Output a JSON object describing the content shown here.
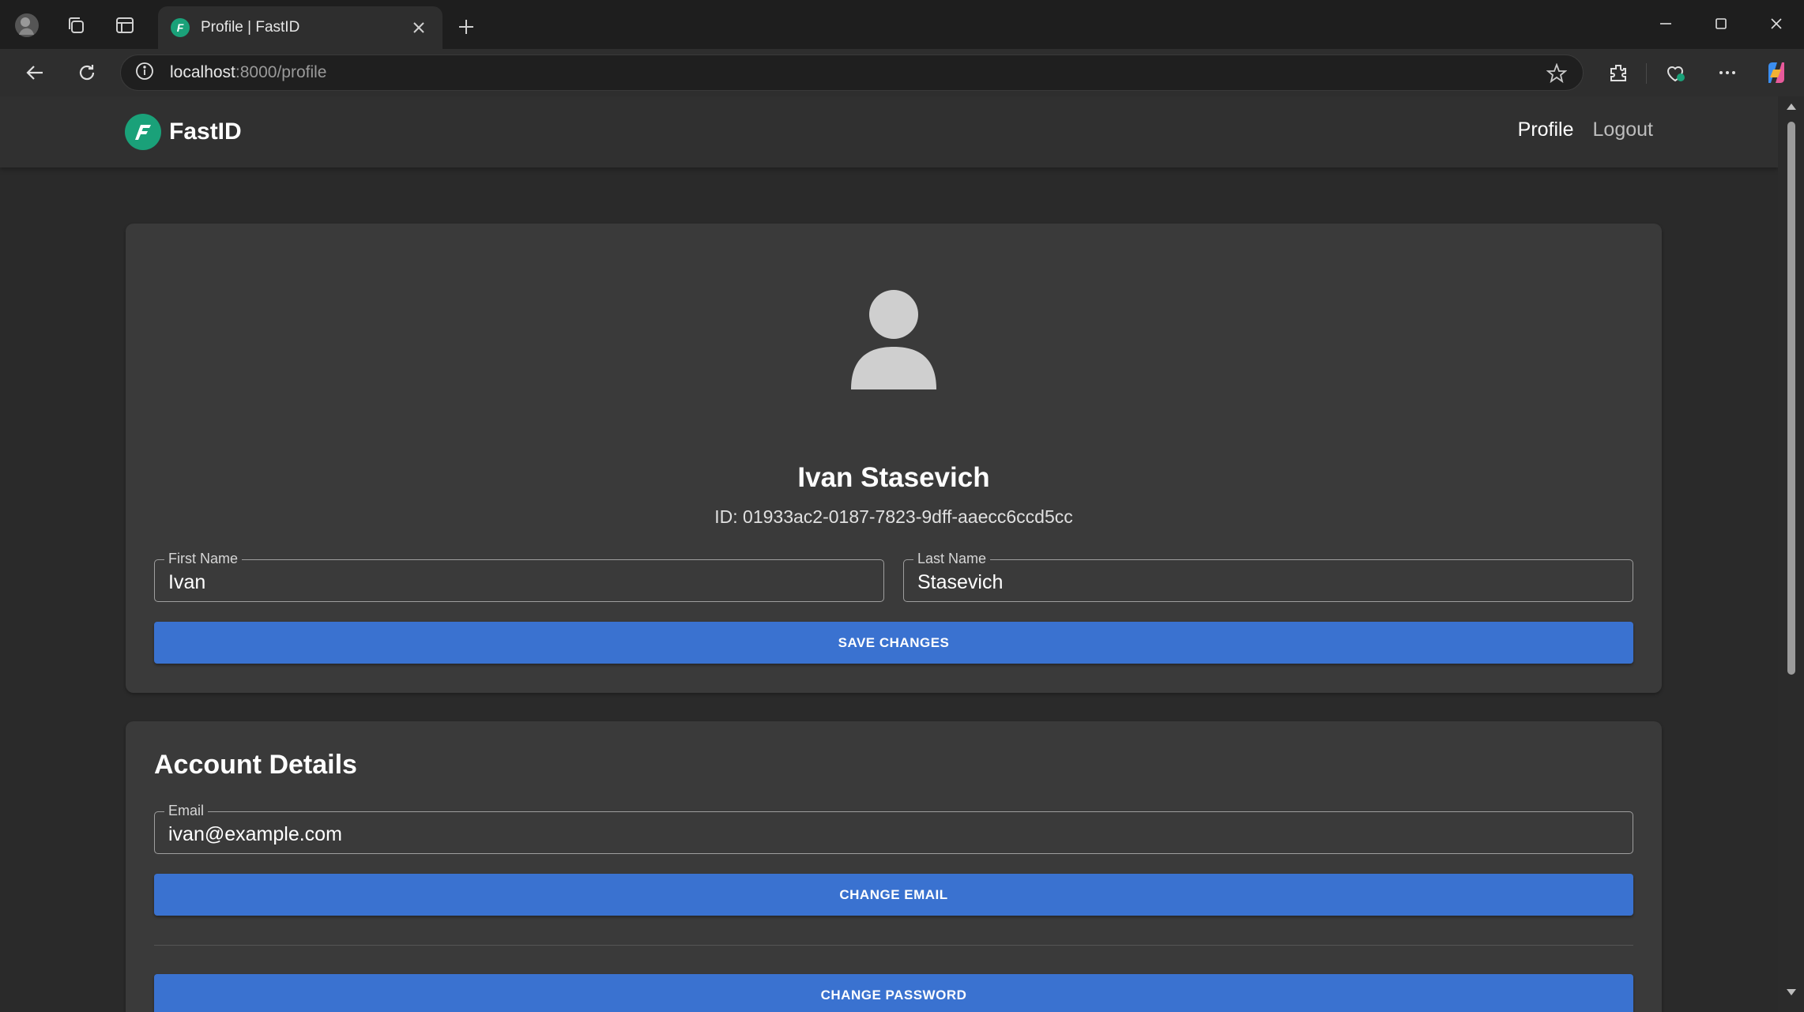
{
  "browser": {
    "tab_title": "Profile | FastID",
    "url_host": "localhost",
    "url_rest": ":8000/profile",
    "favicon_letter": "F"
  },
  "app": {
    "brand": "FastID",
    "logo_letter": "F",
    "nav": {
      "profile": "Profile",
      "logout": "Logout"
    }
  },
  "profile": {
    "full_name": "Ivan Stasevich",
    "id_text": "ID: 01933ac2-0187-7823-9dff-aaecc6ccd5cc",
    "first_name_label": "First Name",
    "first_name_value": "Ivan",
    "last_name_label": "Last Name",
    "last_name_value": "Stasevich",
    "save_button": "SAVE CHANGES"
  },
  "account": {
    "title": "Account Details",
    "email_label": "Email",
    "email_value": "ivan@example.com",
    "change_email_button": "CHANGE EMAIL",
    "change_password_button": "CHANGE PASSWORD"
  },
  "colors": {
    "accent_button": "#3a72d0",
    "brand_green": "#1aa179",
    "card_bg": "#3a3a3a",
    "page_bg": "#2a2a2a"
  }
}
